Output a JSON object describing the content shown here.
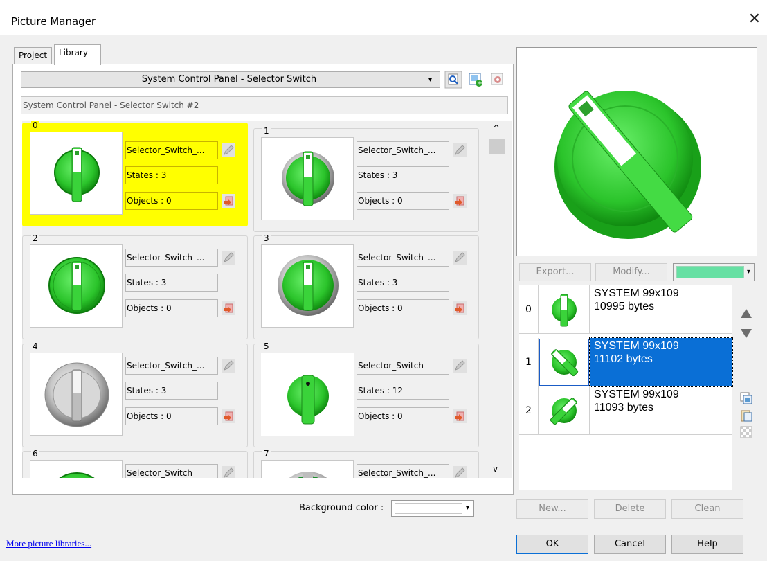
{
  "window": {
    "title": "Picture Manager",
    "close_glyph": "✕"
  },
  "tabs": [
    {
      "label": "Project",
      "active": false
    },
    {
      "label": "Library",
      "active": true
    }
  ],
  "library_select": {
    "value": "System Control Panel - Selector Switch"
  },
  "library_subtitle": "System Control Panel - Selector Switch #2",
  "toolbar_icons": [
    "preview-search-icon",
    "add-library-icon",
    "library-settings-icon"
  ],
  "items": [
    {
      "index": "0",
      "name": "Selector_Switch_...",
      "states": "States : 3",
      "objects": "Objects : 0",
      "selected": true
    },
    {
      "index": "1",
      "name": "Selector_Switch_...",
      "states": "States : 3",
      "objects": "Objects : 0"
    },
    {
      "index": "2",
      "name": "Selector_Switch_...",
      "states": "States : 3",
      "objects": "Objects : 0"
    },
    {
      "index": "3",
      "name": "Selector_Switch_...",
      "states": "States : 3",
      "objects": "Objects : 0"
    },
    {
      "index": "4",
      "name": "Selector_Switch_...",
      "states": "States : 3",
      "objects": "Objects : 0"
    },
    {
      "index": "5",
      "name": "Selector_Switch",
      "states": "States : 12",
      "objects": "Objects : 0"
    },
    {
      "index": "6",
      "name": "Selector_Switch"
    },
    {
      "index": "7",
      "name": "Selector_Switch_..."
    }
  ],
  "scroll_arrows": {
    "up": "^",
    "down": "v"
  },
  "background_color": {
    "label": "Background color :",
    "value": "#ffffff"
  },
  "more_link": "More picture libraries...",
  "preview_buttons": {
    "export": "Export...",
    "modify": "Modify...",
    "color_value": "#66e0a3"
  },
  "states": [
    {
      "num": "0",
      "line1": "SYSTEM 99x109",
      "line2": "10995 bytes"
    },
    {
      "num": "1",
      "line1": "SYSTEM 99x109",
      "line2": "11102 bytes",
      "selected": true
    },
    {
      "num": "2",
      "line1": "SYSTEM 99x109",
      "line2": "11093 bytes"
    }
  ],
  "state_side_icons": [
    "move-up-icon",
    "move-down-icon",
    "copy-image-icon",
    "paste-image-icon",
    "transparent-icon"
  ],
  "state_buttons": {
    "new": "New...",
    "delete": "Delete",
    "clean": "Clean"
  },
  "dialog_buttons": {
    "ok": "OK",
    "cancel": "Cancel",
    "help": "Help"
  },
  "colors": {
    "accent": "#0a6fd6",
    "selection_yellow": "#ffff00",
    "knob_green": "#2ecc40"
  }
}
